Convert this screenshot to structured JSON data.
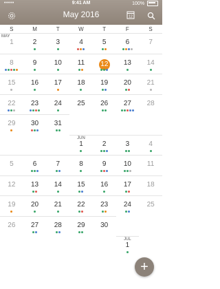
{
  "status_bar": {
    "carrier": "•••••",
    "time": "9:41 AM",
    "battery": "100%"
  },
  "header": {
    "title": "May 2016",
    "calendar_icon_day": "12"
  },
  "weekdays": [
    "S",
    "M",
    "T",
    "W",
    "T",
    "F",
    "S"
  ],
  "colors": {
    "green": "#3aa56a",
    "blue": "#4a7fd0",
    "red": "#e0574f",
    "orange": "#ea8a1a",
    "gray": "#b5b5b5",
    "today": "#ea8a1a"
  },
  "weeks": [
    {
      "label": "MAY",
      "cells": [
        {
          "d": "1",
          "dots": []
        },
        {
          "d": "2",
          "dots": [
            "green"
          ]
        },
        {
          "d": "3",
          "dots": [
            "green"
          ]
        },
        {
          "d": "4",
          "dots": [
            "red",
            "orange",
            "blue"
          ]
        },
        {
          "d": "5",
          "dots": [
            "green",
            "orange"
          ]
        },
        {
          "d": "6",
          "dots": [
            "green",
            "orange",
            "blue",
            "gray"
          ]
        },
        {
          "d": "7",
          "dots": []
        }
      ]
    },
    {
      "cells": [
        {
          "d": "8",
          "dots": [
            "blue",
            "green",
            "red",
            "green",
            "orange"
          ]
        },
        {
          "d": "9",
          "dots": [
            "green"
          ]
        },
        {
          "d": "10",
          "dots": [
            "green"
          ]
        },
        {
          "d": "11",
          "dots": [
            "green",
            "orange"
          ]
        },
        {
          "d": "12",
          "today": true,
          "dots": [
            "green",
            "green",
            "blue"
          ]
        },
        {
          "d": "13",
          "dots": [
            "green"
          ]
        },
        {
          "d": "14",
          "dots": [
            "green"
          ]
        }
      ]
    },
    {
      "cells": [
        {
          "d": "15",
          "dots": [
            "gray"
          ]
        },
        {
          "d": "16",
          "dots": [
            "green"
          ]
        },
        {
          "d": "17",
          "dots": [
            "orange"
          ]
        },
        {
          "d": "18",
          "dots": [
            "green"
          ]
        },
        {
          "d": "19",
          "dots": [
            "green",
            "blue"
          ]
        },
        {
          "d": "20",
          "dots": [
            "green",
            "red"
          ]
        },
        {
          "d": "21",
          "dots": [
            "gray"
          ]
        }
      ]
    },
    {
      "cells": [
        {
          "d": "22",
          "dots": [
            "blue",
            "green",
            "gray"
          ]
        },
        {
          "d": "23",
          "dots": [
            "blue",
            "green",
            "red",
            "green"
          ]
        },
        {
          "d": "24",
          "dots": [
            "green"
          ]
        },
        {
          "d": "25",
          "dots": []
        },
        {
          "d": "26",
          "dots": [
            "green",
            "green"
          ]
        },
        {
          "d": "27",
          "dots": [
            "green",
            "green",
            "red",
            "blue",
            "blue"
          ]
        },
        {
          "d": "28",
          "dots": []
        }
      ]
    },
    {
      "cells": [
        {
          "d": "29",
          "dots": [
            "orange"
          ]
        },
        {
          "d": "30",
          "dots": [
            "red",
            "green",
            "blue"
          ]
        },
        {
          "d": "31",
          "dots": [
            "green",
            "green"
          ]
        },
        {
          "d": "",
          "dots": []
        },
        {
          "d": "",
          "dots": []
        },
        {
          "d": "",
          "dots": []
        },
        {
          "d": "",
          "dots": []
        }
      ]
    },
    {
      "cells": [
        {
          "d": "",
          "dots": []
        },
        {
          "d": "",
          "dots": []
        },
        {
          "d": "",
          "dots": []
        },
        {
          "d": "1",
          "label": "JUN",
          "dots": [
            "green"
          ]
        },
        {
          "d": "2",
          "dots": [
            "green",
            "green",
            "blue"
          ]
        },
        {
          "d": "3",
          "dots": [
            "green",
            "green"
          ]
        },
        {
          "d": "4",
          "dots": [
            "green"
          ]
        }
      ]
    },
    {
      "cells": [
        {
          "d": "5",
          "dots": []
        },
        {
          "d": "6",
          "dots": [
            "green",
            "green",
            "blue"
          ]
        },
        {
          "d": "7",
          "dots": [
            "green",
            "blue"
          ]
        },
        {
          "d": "8",
          "dots": [
            "green"
          ]
        },
        {
          "d": "9",
          "dots": [
            "green",
            "red",
            "blue"
          ]
        },
        {
          "d": "10",
          "dots": [
            "green",
            "green",
            "gray"
          ]
        },
        {
          "d": "11",
          "dots": []
        }
      ]
    },
    {
      "cells": [
        {
          "d": "12",
          "dots": []
        },
        {
          "d": "13",
          "dots": [
            "green",
            "red"
          ]
        },
        {
          "d": "14",
          "dots": [
            "green"
          ]
        },
        {
          "d": "15",
          "dots": [
            "green",
            "blue"
          ]
        },
        {
          "d": "16",
          "dots": [
            "green"
          ]
        },
        {
          "d": "17",
          "dots": [
            "green",
            "red"
          ]
        },
        {
          "d": "18",
          "dots": []
        }
      ]
    },
    {
      "cells": [
        {
          "d": "19",
          "dots": [
            "orange"
          ]
        },
        {
          "d": "20",
          "dots": [
            "green"
          ]
        },
        {
          "d": "21",
          "dots": [
            "green"
          ]
        },
        {
          "d": "22",
          "dots": [
            "green",
            "red"
          ]
        },
        {
          "d": "23",
          "dots": [
            "green",
            "orange"
          ]
        },
        {
          "d": "24",
          "dots": [
            "green",
            "blue"
          ]
        },
        {
          "d": "25",
          "dots": []
        }
      ]
    },
    {
      "cells": [
        {
          "d": "26",
          "dots": []
        },
        {
          "d": "27",
          "dots": [
            "green",
            "blue"
          ]
        },
        {
          "d": "28",
          "dots": [
            "green",
            "blue"
          ]
        },
        {
          "d": "29",
          "dots": [
            "green",
            "green"
          ]
        },
        {
          "d": "30",
          "dots": []
        },
        {
          "d": "",
          "dots": []
        },
        {
          "d": "",
          "dots": []
        }
      ]
    },
    {
      "cells": [
        {
          "d": "",
          "dots": []
        },
        {
          "d": "",
          "dots": []
        },
        {
          "d": "",
          "dots": []
        },
        {
          "d": "",
          "dots": []
        },
        {
          "d": "",
          "dots": []
        },
        {
          "d": "1",
          "label": "JUL",
          "dots": [
            "green"
          ]
        },
        {
          "d": "",
          "dots": []
        }
      ]
    }
  ],
  "fab_label": "+"
}
